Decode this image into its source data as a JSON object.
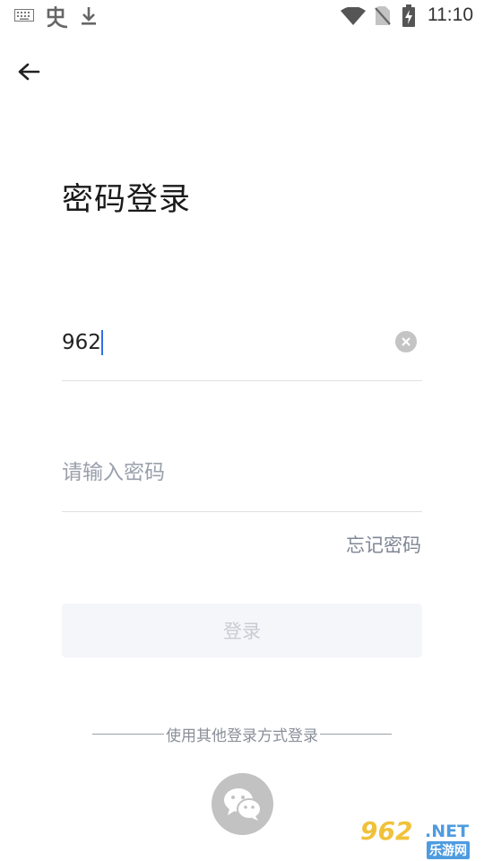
{
  "status_bar": {
    "time": "11:10",
    "icons": [
      "keyboard-icon",
      "bug-icon",
      "download-icon",
      "wifi-icon",
      "no-sim-icon",
      "battery-charging-icon"
    ]
  },
  "header": {
    "back_icon": "arrow-left-icon"
  },
  "page": {
    "title": "密码登录"
  },
  "form": {
    "account_value": "962",
    "password_placeholder": "请输入密码",
    "forgot_label": "忘记密码",
    "login_label": "登录"
  },
  "other_login": {
    "divider_text": "使用其他登录方式登录",
    "wechat_icon": "wechat-icon"
  },
  "watermark": {
    "main": "962",
    "net": ".NET",
    "sub": "乐游网"
  },
  "colors": {
    "accent_caret": "#2f6fe8",
    "login_button_bg": "#f4f6f9",
    "login_button_text": "#c8ccd4",
    "placeholder": "#9aa0ab",
    "wechat_bg": "#c2c2c2"
  }
}
